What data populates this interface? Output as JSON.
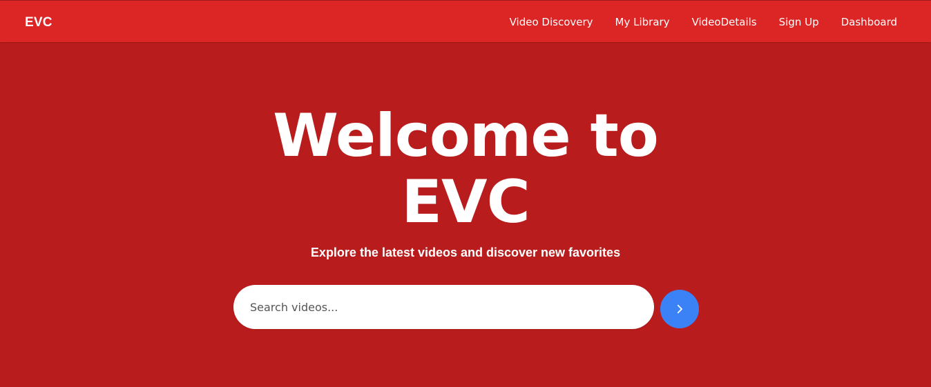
{
  "navbar": {
    "brand": "EVC",
    "links": [
      {
        "label": "Video Discovery"
      },
      {
        "label": "My Library"
      },
      {
        "label": "VideoDetails"
      },
      {
        "label": "Sign Up"
      },
      {
        "label": "Dashboard"
      }
    ]
  },
  "hero": {
    "title": "Welcome to EVC",
    "subtitle": "Explore the latest videos and discover new favorites",
    "search": {
      "placeholder": "Search videos...",
      "value": "",
      "button_icon": "chevron-right-icon"
    }
  },
  "colors": {
    "navbar_bg": "#dc2626",
    "hero_bg": "#b91c1c",
    "search_button_bg": "#3b82f6",
    "text": "#ffffff"
  }
}
